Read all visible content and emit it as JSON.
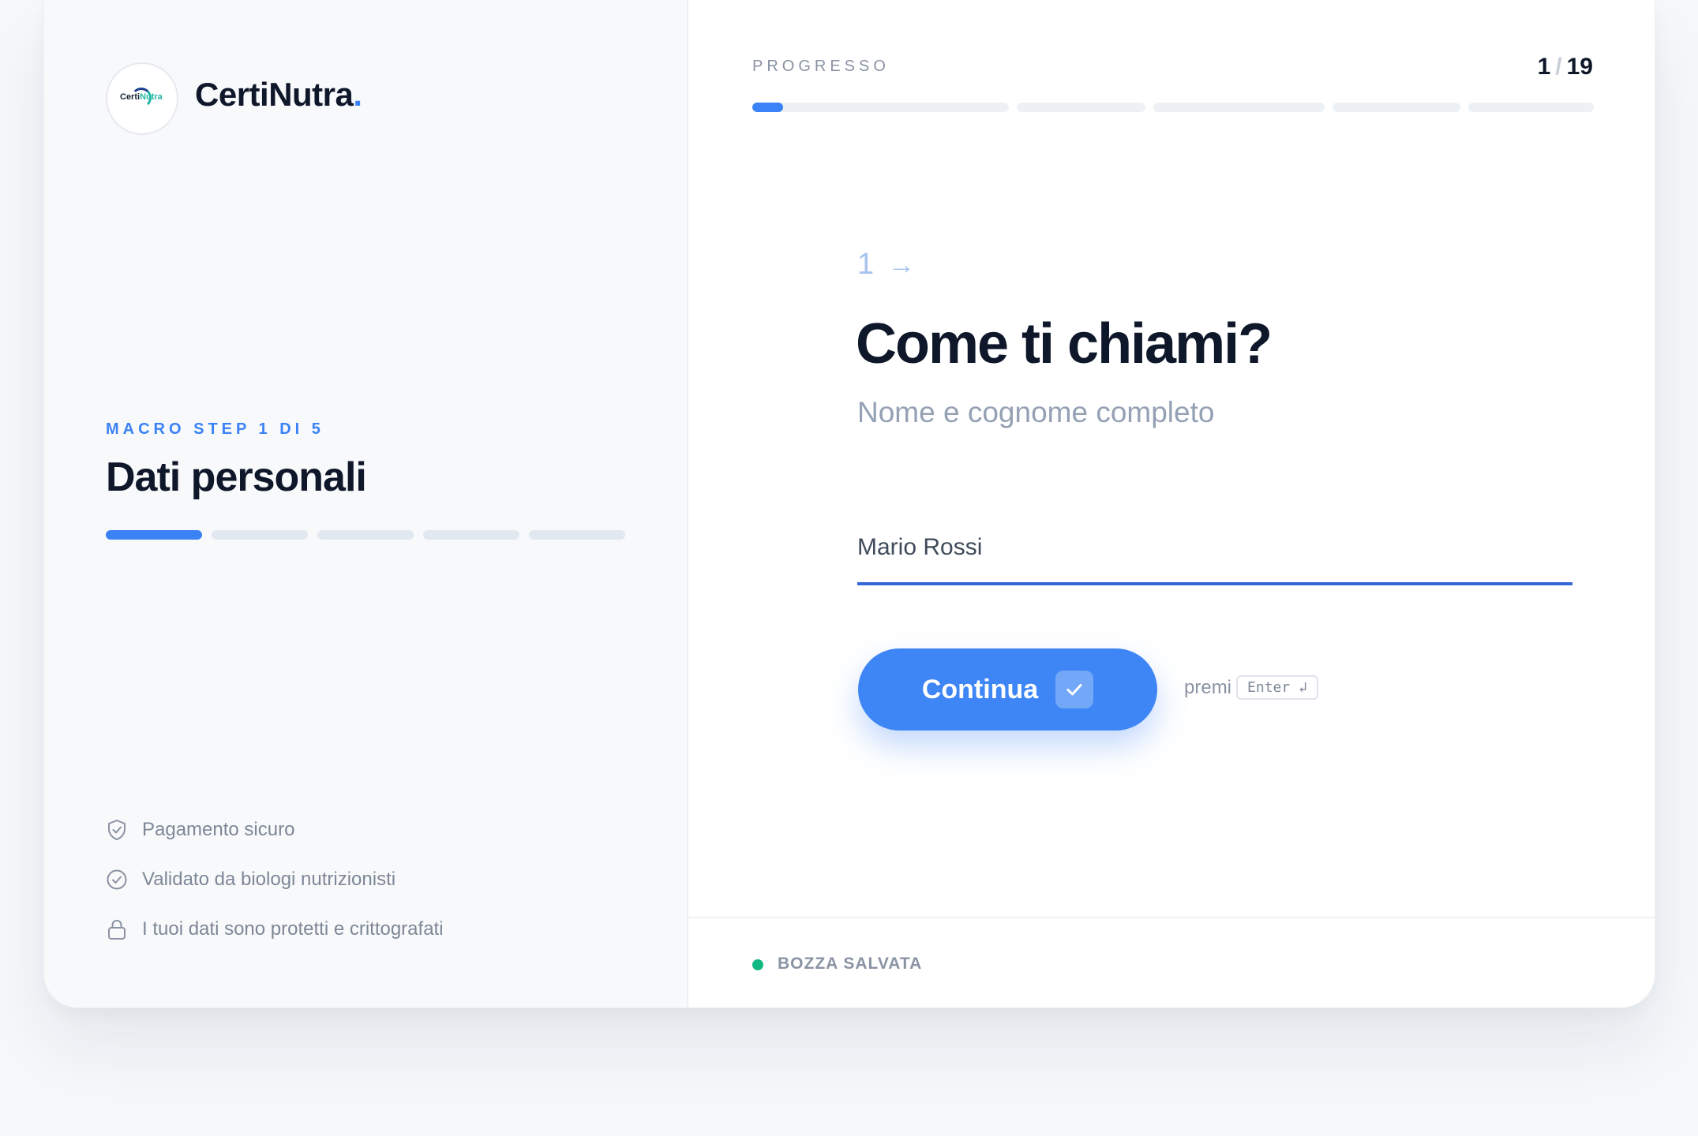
{
  "brand": {
    "logo_text_part1": "Certi",
    "logo_text_part2": "Nutra",
    "name": "CertiNutra",
    "dot": "."
  },
  "sidebar": {
    "macro_label": "MACRO STEP 1 DI 5",
    "section_title": "Dati personali",
    "macro_steps_total": 5,
    "macro_step_current": 1,
    "trust_items": [
      {
        "icon": "shield-check-icon",
        "label": "Pagamento sicuro"
      },
      {
        "icon": "circle-check-icon",
        "label": "Validato da biologi nutrizionisti"
      },
      {
        "icon": "lock-icon",
        "label": "I tuoi dati sono protetti e crittografati"
      }
    ]
  },
  "progress": {
    "label": "PROGRESSO",
    "current": "1",
    "separator": "/",
    "total": "19",
    "fill_fraction_first_segment": 0.12
  },
  "question": {
    "number": "1",
    "arrow": "→",
    "title": "Come ti chiami?",
    "subtitle": "Nome e cognome completo",
    "input_value": "Mario Rossi"
  },
  "actions": {
    "continue_label": "Continua",
    "hint_prefix": "premi",
    "hint_key": "Enter ↲"
  },
  "footer": {
    "status": "BOZZA SALVATA"
  },
  "colors": {
    "accent": "#3b82f6",
    "text_dark": "#0f172a",
    "muted": "#8a93a3",
    "success": "#10b981"
  }
}
